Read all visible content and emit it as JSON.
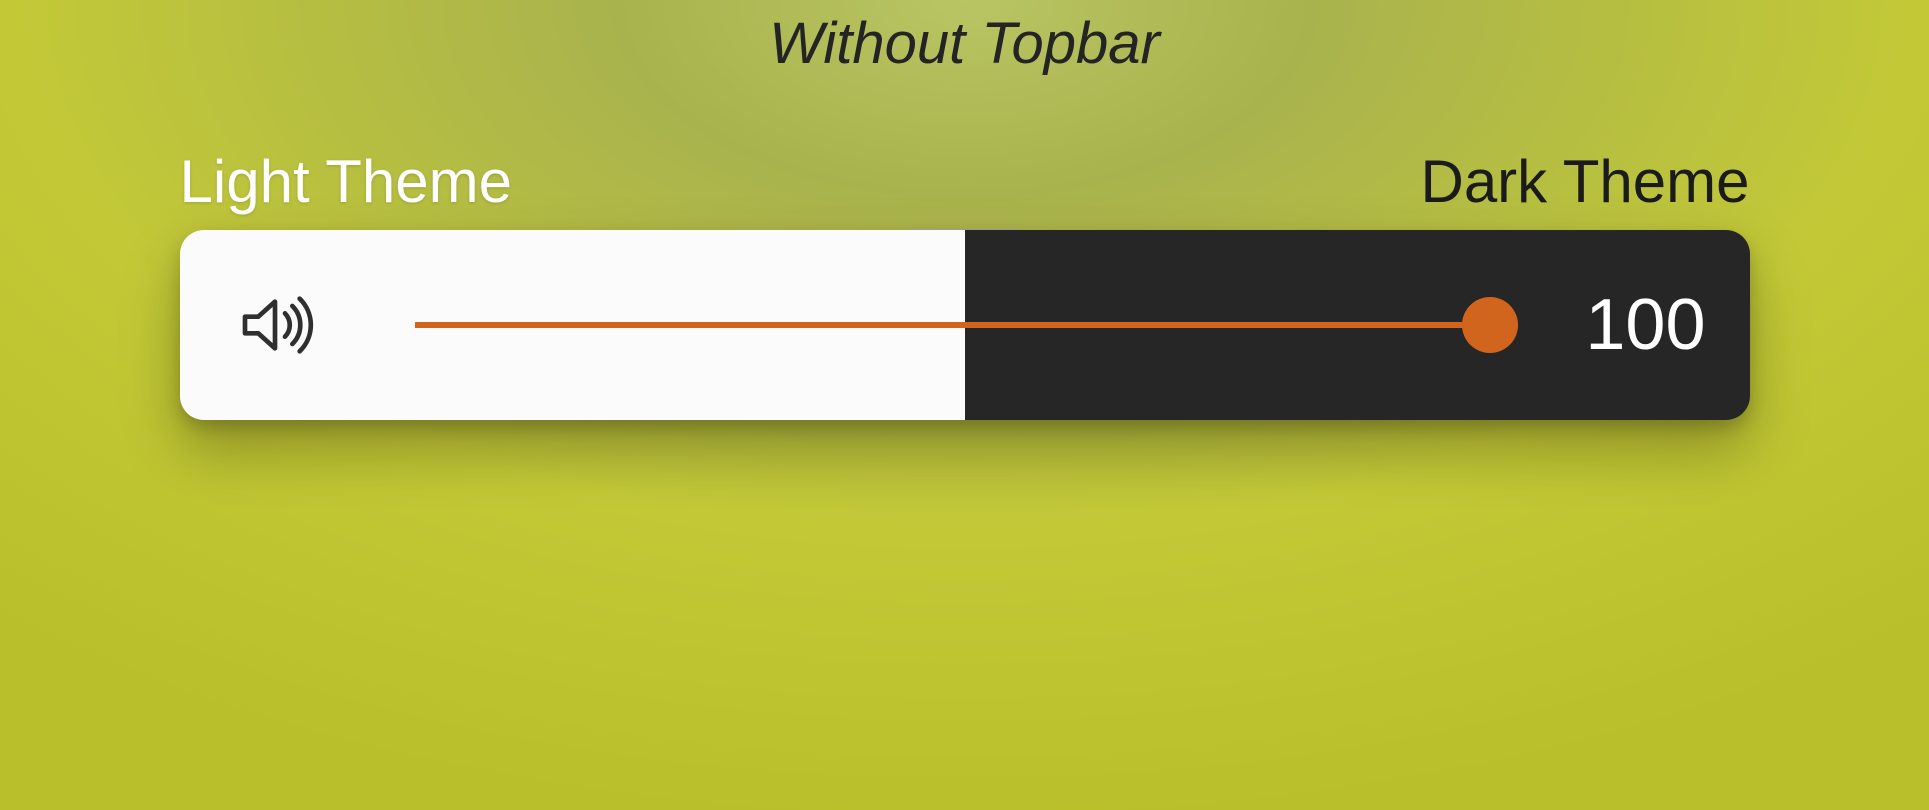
{
  "title": "Without Topbar",
  "labels": {
    "left": "Light Theme",
    "right": "Dark Theme"
  },
  "slider": {
    "icon": "volume-high-icon",
    "value": "100",
    "percent": 100
  },
  "colors": {
    "accent": "#d2651e",
    "light_bg": "#fbfbfb",
    "dark_bg": "#272626"
  }
}
